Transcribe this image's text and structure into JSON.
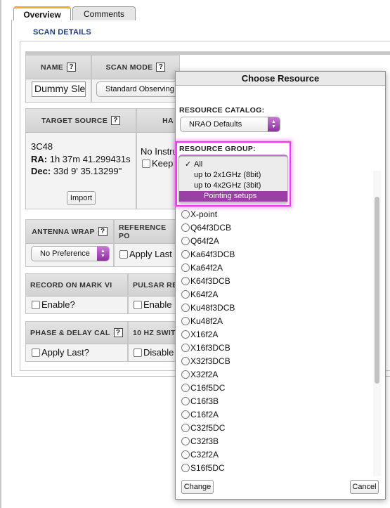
{
  "tabs": [
    {
      "label": "Overview",
      "active": true
    },
    {
      "label": "Comments",
      "active": false
    }
  ],
  "section_title": "SCAN DETAILS",
  "name_cell": {
    "header": "NAME",
    "help": "?",
    "value": "Dummy Slew"
  },
  "scan_mode_cell": {
    "header": "SCAN MODE",
    "help": "?",
    "value": "Standard Observing"
  },
  "target_cell": {
    "header": "TARGET SOURCE",
    "help": "?",
    "source": "3C48",
    "ra_label": "RA:",
    "ra_value": "1h 37m 41.299431s",
    "dec_label": "Dec:",
    "dec_value": "33d 9' 35.13299\"",
    "import_label": "Import"
  },
  "ha_cell": {
    "header": "HA",
    "text": "No Instru",
    "check_label": "Keep"
  },
  "antenna_wrap_cell": {
    "header": "ANTENNA WRAP",
    "help": "?",
    "value": "No Preference"
  },
  "reference_cell": {
    "header": "REFERENCE PO",
    "check_label": "Apply Last"
  },
  "record_cell": {
    "header": "RECORD ON MARK VI",
    "check_label": "Enable?"
  },
  "pulsar_cell": {
    "header": "PULSAR RE",
    "check_label": "Enable"
  },
  "phase_cell": {
    "header": "PHASE & DELAY CAL",
    "help": "?",
    "check_label": "Apply Last?"
  },
  "switch_cell": {
    "header": "10 HZ SWIT",
    "check_label": "Disable"
  },
  "dialog": {
    "title": "Choose Resource",
    "catalog_label": "RESOURCE CATALOG:",
    "catalog_value": "NRAO Defaults",
    "group_label": "RESOURCE GROUP:",
    "group_options": [
      {
        "label": "All",
        "checked": true
      },
      {
        "label": "up to 2x1GHz (8bit)",
        "checked": false
      },
      {
        "label": "up to 4x2GHz (3bit)",
        "checked": false
      },
      {
        "label": "Pointing setups",
        "checked": false,
        "highlighted": true
      }
    ],
    "check_mark": "✓",
    "resources": [
      "X-point",
      "Q64f3DCB",
      "Q64f2A",
      "Ka64f3DCB",
      "Ka64f2A",
      "K64f3DCB",
      "K64f2A",
      "Ku48f3DCB",
      "Ku48f2A",
      "X16f2A",
      "X16f3DCB",
      "X32f3DCB",
      "X32f2A",
      "C16f5DC",
      "C16f3B",
      "C16f2A",
      "C32f5DC",
      "C32f3B",
      "C32f2A",
      "S16f5DC"
    ],
    "change_label": "Change",
    "cancel_label": "Cancel"
  },
  "colors": {
    "accent_purple": "#9b3fa6",
    "highlight_magenta": "#ff33ff",
    "tab_active_accent": "#f0a830",
    "section_title": "#1e3a78"
  }
}
